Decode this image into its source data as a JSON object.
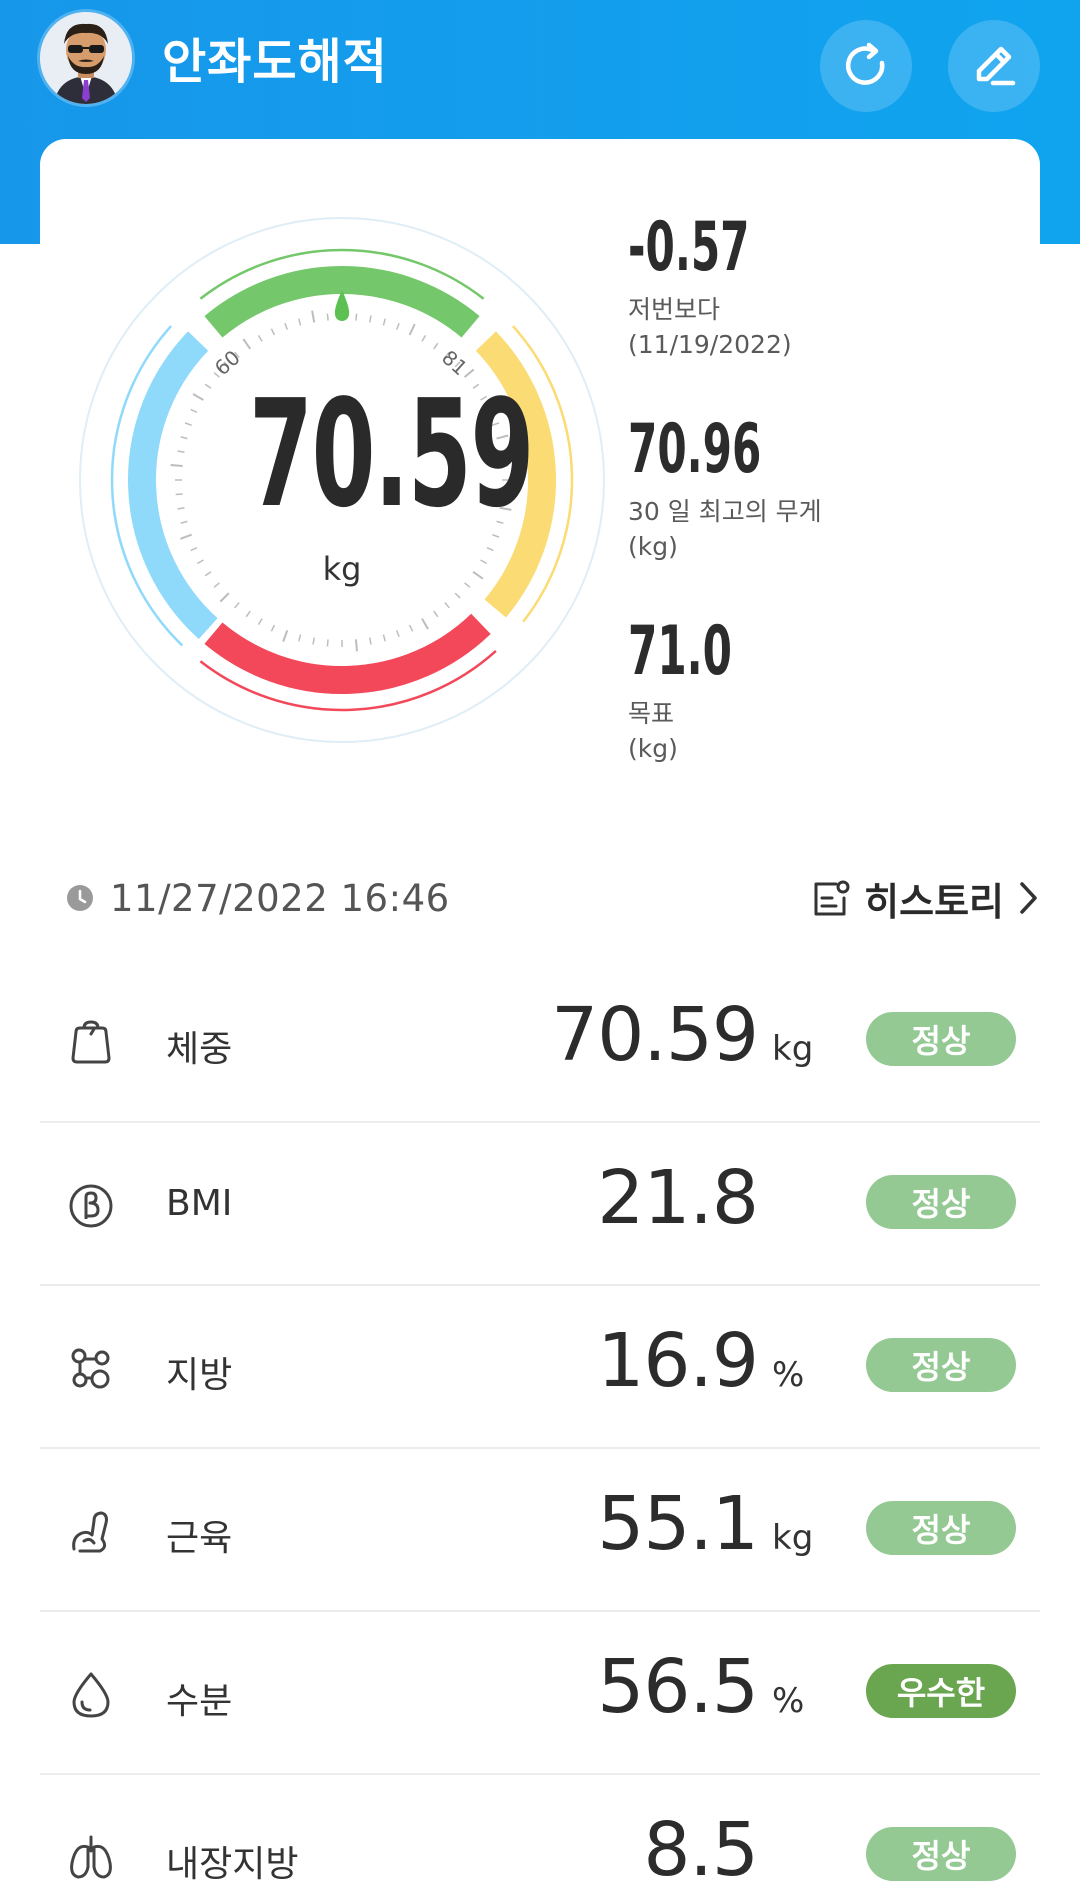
{
  "header": {
    "username": "안좌도해적",
    "refresh_icon": "refresh-icon",
    "edit_icon": "edit-pencil-icon"
  },
  "gauge": {
    "value": "70.59",
    "unit": "kg",
    "tick_left": "60",
    "tick_right": "81",
    "segments": {
      "low": "#8fd9fb",
      "normal": "#74c76a",
      "high": "#fbdb73",
      "very_high": "#f2485a"
    },
    "indicator_color": "#5cc152"
  },
  "stats": [
    {
      "value": "-0.57",
      "label": "저번보다",
      "sub": "(11/19/2022)"
    },
    {
      "value": "70.96",
      "label": "30 일 최고의 무게",
      "sub": "(kg)"
    },
    {
      "value": "71.0",
      "label": "목표",
      "sub": "(kg)"
    }
  ],
  "measurement": {
    "clock_icon": "clock-icon",
    "datetime": "11/27/2022 16:46",
    "history_icon": "history-icon",
    "history_label": "히스토리",
    "chevron_icon": "chevron-right-icon"
  },
  "metrics": [
    {
      "name": "체중",
      "value": "70.59",
      "unit": "kg",
      "status": "정상",
      "icon": "weight-scale-icon",
      "status_color": "#94c994"
    },
    {
      "name": "BMI",
      "value": "21.8",
      "unit": "",
      "status": "정상",
      "icon": "bmi-icon",
      "status_color": "#94c994"
    },
    {
      "name": "지방",
      "value": "16.9",
      "unit": "%",
      "status": "정상",
      "icon": "fat-icon",
      "status_color": "#94c994"
    },
    {
      "name": "근육",
      "value": "55.1",
      "unit": "kg",
      "status": "정상",
      "icon": "muscle-icon",
      "status_color": "#94c994"
    },
    {
      "name": "수분",
      "value": "56.5",
      "unit": "%",
      "status": "우수한",
      "icon": "water-drop-icon",
      "status_color": "#6aa64f"
    },
    {
      "name": "내장지방",
      "value": "8.5",
      "unit": "",
      "status": "정상",
      "icon": "visceral-fat-icon",
      "status_color": "#94c994"
    }
  ]
}
